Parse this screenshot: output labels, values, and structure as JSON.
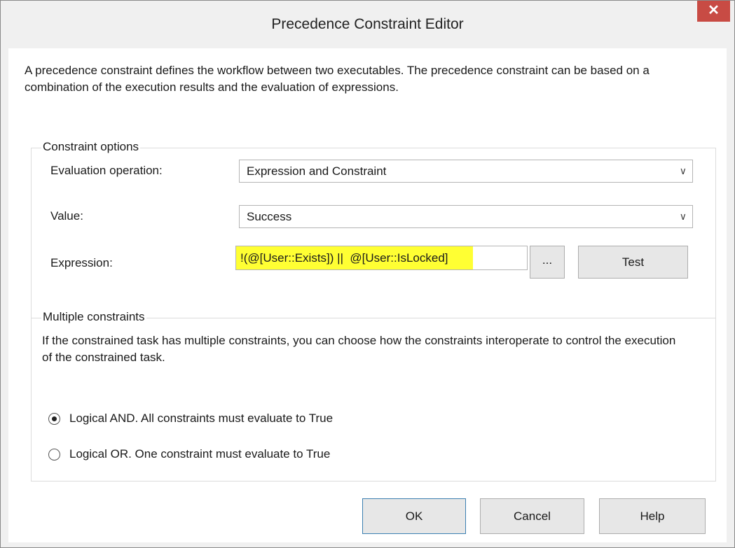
{
  "window": {
    "title": "Precedence Constraint Editor",
    "close_glyph": "✕"
  },
  "description": "A precedence constraint defines the workflow between two executables. The precedence constraint can be based on a combination of the execution results and the evaluation of expressions.",
  "constraint_options": {
    "group_label": "Constraint options",
    "evaluation_operation": {
      "label": "Evaluation operation:",
      "value": "Expression and Constraint",
      "arrow_icon": "chevron-down-icon"
    },
    "value": {
      "label": "Value:",
      "value": "Success",
      "arrow_icon": "chevron-down-icon"
    },
    "expression": {
      "label": "Expression:",
      "value": "!(@[User::Exists]) ||  @[User::IsLocked]",
      "highlight_color": "#ffff33"
    },
    "ellipsis_label": "...",
    "test_label": "Test"
  },
  "multiple_constraints": {
    "group_label": "Multiple constraints",
    "description": "If the constrained task has multiple constraints, you can choose how the constraints interoperate to control the execution of the constrained task.",
    "options": [
      {
        "label": "Logical AND. All constraints must evaluate to True",
        "checked": true
      },
      {
        "label": "Logical OR. One constraint must evaluate to True",
        "checked": false
      }
    ]
  },
  "buttons": {
    "ok": "OK",
    "cancel": "Cancel",
    "help": "Help"
  },
  "colors": {
    "close_button": "#c84b44",
    "default_button_border": "#3c7fb1"
  }
}
